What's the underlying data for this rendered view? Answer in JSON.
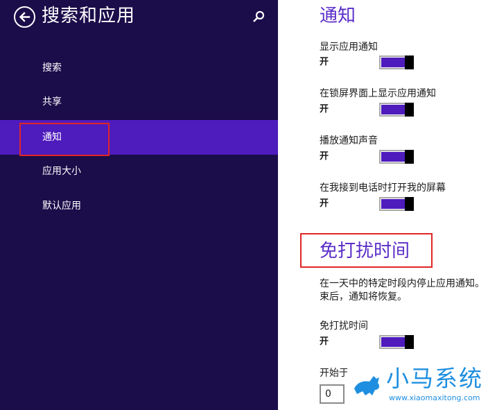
{
  "sidebar": {
    "title": "搜索和应用",
    "items": [
      {
        "label": "搜索"
      },
      {
        "label": "共享"
      },
      {
        "label": "通知"
      },
      {
        "label": "应用大小"
      },
      {
        "label": "默认应用"
      }
    ],
    "selected_index": 2
  },
  "main": {
    "notifications": {
      "title": "通知",
      "settings": [
        {
          "label": "显示应用通知",
          "state": "开",
          "on": true
        },
        {
          "label": "在锁屏界面上显示应用通知",
          "state": "开",
          "on": true
        },
        {
          "label": "播放通知声音",
          "state": "开",
          "on": true
        },
        {
          "label": "在我接到电话时打开我的屏幕",
          "state": "开",
          "on": true
        }
      ]
    },
    "quiet_hours": {
      "title": "免打扰时间",
      "description_line1": "在一天中的特定时段内停止应用通知。",
      "description_line2": "束后，通知将恢复。",
      "toggle_label": "免打扰时间",
      "toggle_state": "开",
      "start_label": "开始于",
      "start_value": "0"
    }
  },
  "watermark": {
    "text": "小马系统",
    "url": "www.xiaomaxitong.com"
  },
  "colors": {
    "sidebar_bg": "#1b0c4a",
    "accent": "#4e1bbd",
    "title": "#5a2dc8",
    "highlight": "#e02525",
    "watermark": "#1e8fe0"
  },
  "icons": [
    "back-arrow-icon",
    "search-icon",
    "horse-logo-icon"
  ]
}
